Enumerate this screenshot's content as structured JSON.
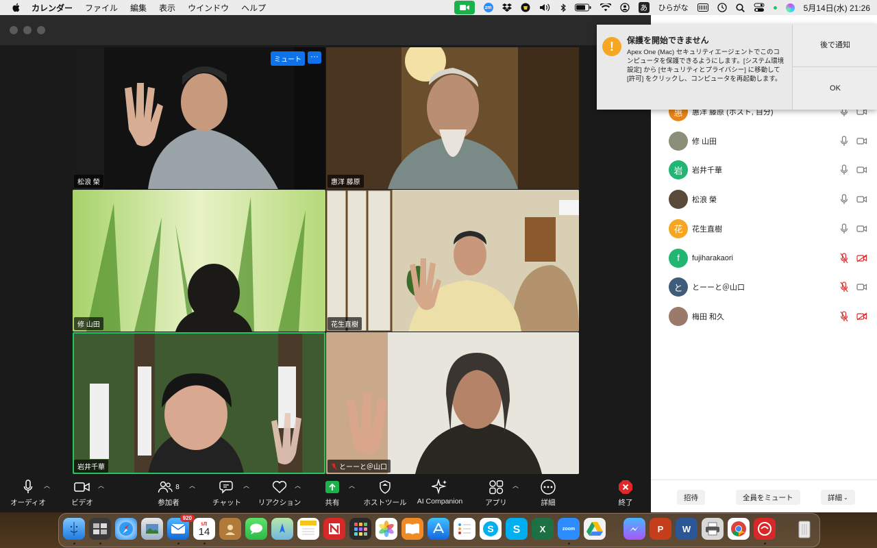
{
  "menubar": {
    "app_name": "カレンダー",
    "menus": [
      "ファイル",
      "編集",
      "表示",
      "ウインドウ",
      "ヘルプ"
    ],
    "ime_char": "あ",
    "ime_mode": "ひらがな",
    "datetime": "5月14日(水)  21:26"
  },
  "video": {
    "mute_label": "ミュート",
    "more_label": "···",
    "tiles": [
      {
        "name": "松浪 榮"
      },
      {
        "name": "惠洋 藤原"
      },
      {
        "name": "修 山田"
      },
      {
        "name": "花生直樹"
      },
      {
        "name": "岩井千華"
      },
      {
        "name": "とーーと＠山口"
      }
    ]
  },
  "toolbar": {
    "audio": "オーディオ",
    "video": "ビデオ",
    "participants": "参加者",
    "participants_count": "8",
    "chat": "チャット",
    "reactions": "リアクション",
    "share": "共有",
    "host_tools": "ホストツール",
    "ai_companion": "AI Companion",
    "apps": "アプリ",
    "more": "詳細",
    "end": "終了"
  },
  "participants": [
    {
      "name": "惠洋 藤原 (ホスト, 自分)",
      "initial": "惠",
      "color": "#e8851a",
      "mic_muted": false,
      "cam_off": false
    },
    {
      "name": "修 山田",
      "initial": "",
      "color": "#8a8f7a",
      "mic_muted": false,
      "cam_off": false
    },
    {
      "name": "岩井千華",
      "initial": "岩",
      "color": "#22b573",
      "mic_muted": false,
      "cam_off": false
    },
    {
      "name": "松浪 榮",
      "initial": "",
      "color": "#5a4a3a",
      "mic_muted": false,
      "cam_off": false
    },
    {
      "name": "花生直樹",
      "initial": "花",
      "color": "#f5a623",
      "mic_muted": false,
      "cam_off": false
    },
    {
      "name": "fujiharakaori",
      "initial": "f",
      "color": "#22b573",
      "mic_muted": true,
      "cam_off": true
    },
    {
      "name": "とーーと＠山口",
      "initial": "と",
      "color": "#3f5d7a",
      "mic_muted": true,
      "cam_off": false
    },
    {
      "name": "梅田 和久",
      "initial": "",
      "color": "#9a7a6a",
      "mic_muted": true,
      "cam_off": true
    }
  ],
  "panel_footer": {
    "invite": "招待",
    "mute_all": "全員をミュート",
    "more": "詳細"
  },
  "notification": {
    "title": "保護を開始できません",
    "body": "Apex One (Mac) セキュリティエージェントでこのコンピュータを保護できるようにします。[システム環境設定] から [セキュリティとプライバシー] に移動して [許可] をクリックし、コンピュータを再起動します。",
    "later_button": "後で通知",
    "ok_button": "OK"
  },
  "dock": {
    "mail_badge": "920",
    "calendar_month": "5月",
    "calendar_day": "14",
    "zoom_label": "zoom"
  },
  "colors": {
    "zoom_blue": "#0e72ed",
    "active_speaker": "#22c55e",
    "muted_red": "#e02828",
    "end_red": "#e02828"
  }
}
